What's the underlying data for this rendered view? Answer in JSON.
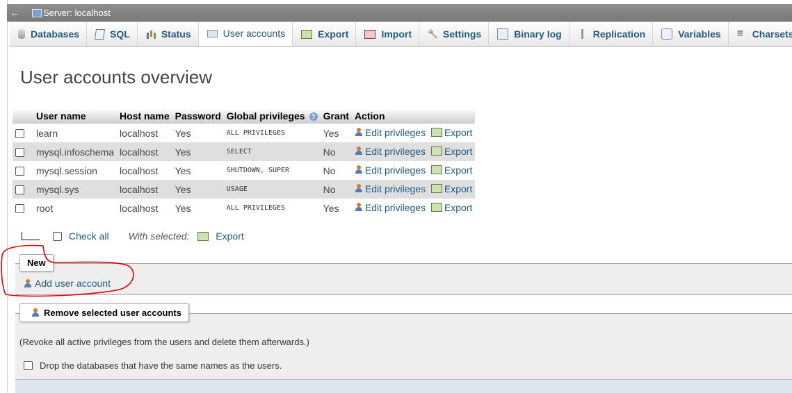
{
  "header": {
    "back_glyph": "←",
    "server_title": "Server: localhost"
  },
  "tabs": [
    {
      "label": "Databases",
      "icon": "database-icon"
    },
    {
      "label": "SQL",
      "icon": "sql-icon"
    },
    {
      "label": "Status",
      "icon": "status-icon"
    },
    {
      "label": "User accounts",
      "icon": "user-accounts-icon",
      "active": true
    },
    {
      "label": "Export",
      "icon": "export-icon"
    },
    {
      "label": "Import",
      "icon": "import-icon"
    },
    {
      "label": "Settings",
      "icon": "wrench-icon"
    },
    {
      "label": "Binary log",
      "icon": "binary-log-icon"
    },
    {
      "label": "Replication",
      "icon": "replication-icon"
    },
    {
      "label": "Variables",
      "icon": "variables-icon"
    },
    {
      "label": "Charsets",
      "icon": "charsets-icon"
    }
  ],
  "page_title": "User accounts overview",
  "table": {
    "headers": [
      "User name",
      "Host name",
      "Password",
      "Global privileges",
      "Grant",
      "Action"
    ],
    "help_glyph": "?",
    "rows": [
      {
        "user": "learn",
        "host": "localhost",
        "password": "Yes",
        "privileges": "ALL PRIVILEGES",
        "grant": "Yes"
      },
      {
        "user": "mysql.infoschema",
        "host": "localhost",
        "password": "Yes",
        "privileges": "SELECT",
        "grant": "No"
      },
      {
        "user": "mysql.session",
        "host": "localhost",
        "password": "Yes",
        "privileges": "SHUTDOWN, SUPER",
        "grant": "No"
      },
      {
        "user": "mysql.sys",
        "host": "localhost",
        "password": "Yes",
        "privileges": "USAGE",
        "grant": "No"
      },
      {
        "user": "root",
        "host": "localhost",
        "password": "Yes",
        "privileges": "ALL PRIVILEGES",
        "grant": "Yes"
      }
    ],
    "edit_label": "Edit privileges",
    "export_label": "Export"
  },
  "bulk": {
    "check_all": "Check all",
    "with_selected": "With selected:",
    "export": "Export"
  },
  "new_section": {
    "legend": "New",
    "add_user": "Add user account"
  },
  "remove_section": {
    "legend": "Remove selected user accounts",
    "note": "(Revoke all active privileges from the users and delete them afterwards.)",
    "drop_label": "Drop the databases that have the same names as the users."
  },
  "colors": {
    "link": "#235a81",
    "header_bar": "#808080",
    "annotation": "#e00000"
  }
}
